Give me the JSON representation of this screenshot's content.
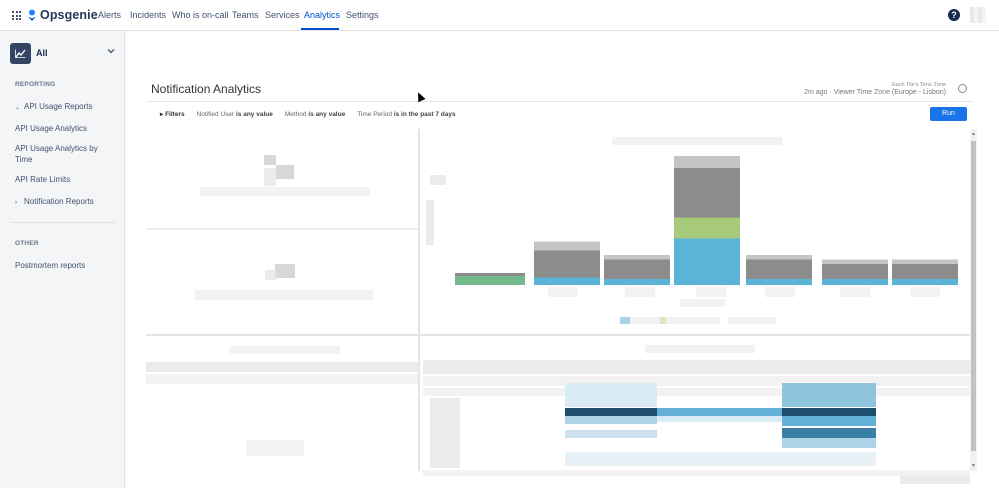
{
  "app": {
    "name": "Opsgenie",
    "brand_color": "#0052cc"
  },
  "topnav": {
    "items": [
      {
        "label": "Alerts",
        "active": false
      },
      {
        "label": "Incidents",
        "active": false
      },
      {
        "label": "Who is on-call",
        "active": false
      },
      {
        "label": "Teams",
        "active": false
      },
      {
        "label": "Services",
        "active": false
      },
      {
        "label": "Analytics",
        "active": true
      },
      {
        "label": "Settings",
        "active": false
      }
    ],
    "help_label": "?"
  },
  "sidebar": {
    "space_name": "All",
    "reporting_heading": "REPORTING",
    "api_usage_group": "API Usage Reports",
    "api_usage_analytics": "API Usage Analytics",
    "api_usage_by_time": "API Usage Analytics by Time",
    "api_rate_limits": "API Rate Limits",
    "notification_reports": "Notification Reports",
    "other_heading": "OTHER",
    "postmortem_reports": "Postmortem reports"
  },
  "page": {
    "title": "Notification Analytics",
    "tz_small": "Each Tile's Time Zone",
    "updated": "2m ago",
    "timezone": "Viewer Time Zone (Europe - Lisbon)",
    "separator": " · "
  },
  "filters": {
    "toggle_label": "Filters",
    "notified_user_key": "Notified User",
    "notified_user_value": "is any value",
    "method_key": "Method",
    "method_value": "is any value",
    "period_key": "Time Period",
    "period_value": "is in the past 7 days",
    "run_label": "Run"
  },
  "chart_data": {
    "type": "bar",
    "stacked": true,
    "categories": [
      "",
      "",
      "",
      "",
      "",
      "",
      ""
    ],
    "series": [
      {
        "color": "#5ab4d6",
        "values": [
          0,
          5,
          4,
          31,
          4,
          4,
          4
        ]
      },
      {
        "color": "#74b98b",
        "values": [
          6,
          0,
          0,
          0,
          0,
          0,
          0
        ]
      },
      {
        "color": "#a7c97a",
        "values": [
          0,
          0,
          0,
          14,
          0,
          0,
          0
        ]
      },
      {
        "color": "#8c8c8c",
        "values": [
          2,
          18,
          13,
          33,
          13,
          10,
          10
        ]
      },
      {
        "color": "#c4c4c4",
        "values": [
          0,
          6,
          3,
          8,
          3,
          3,
          3
        ]
      }
    ],
    "ylim": [
      0,
      90
    ]
  },
  "colors": {
    "run_button": "#1a73e8",
    "heat_dark": "#1d4e6b",
    "heat_mid": "#64b0d6",
    "heat_light": "#d9ebf5"
  }
}
